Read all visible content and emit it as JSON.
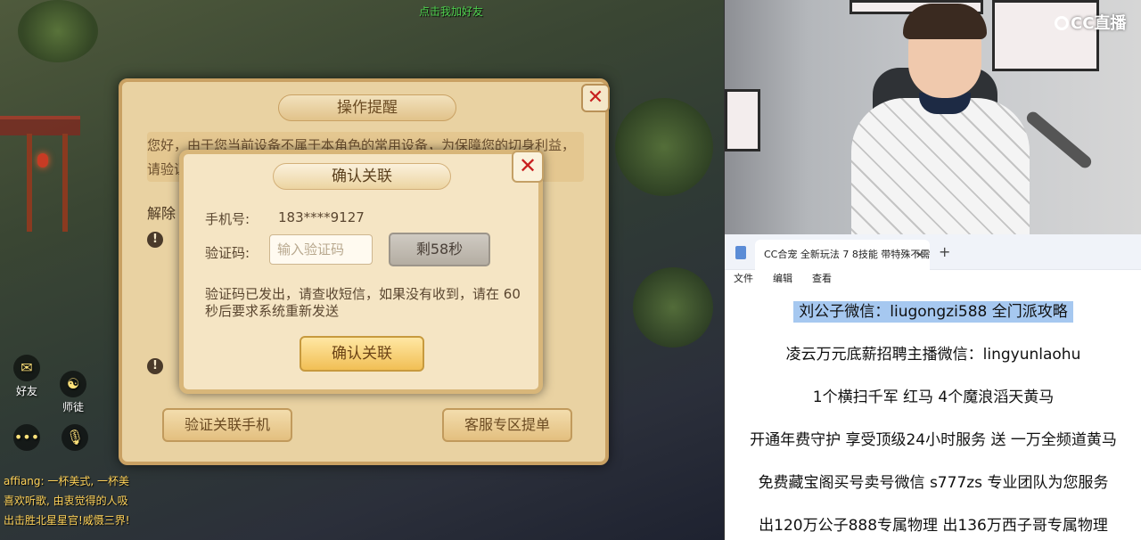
{
  "game": {
    "top_text": "点击我加好友",
    "side_buttons": [
      {
        "label": "好友",
        "icon": "mail-icon"
      },
      {
        "label": "师徒",
        "icon": "master-icon"
      },
      {
        "label": "",
        "icon": "chat-bubble-icon"
      },
      {
        "label": "",
        "icon": "microphone-icon"
      }
    ],
    "chat": [
      "affiang: 一杯美式, 一杯美",
      "  喜欢听歌, 由衷觉得的人吸",
      "出击胜北星星官!威慑三界!"
    ]
  },
  "outer_dialog": {
    "title": "操作提醒",
    "message": "您好，由于您当前设备不属于本角色的常用设备，为保障您的切身利益，请验证关联手机后再进行操作，谢谢您的配合。限制。",
    "section_label": "解除",
    "verify_button": "验证关联手机",
    "support_button": "客服专区提单"
  },
  "inner_dialog": {
    "title": "确认关联",
    "phone_label": "手机号:",
    "phone_value": "183****9127",
    "code_label": "验证码:",
    "code_placeholder": "输入验证码",
    "countdown_button": "剩58秒",
    "notice": "验证码已发出，请查收短信，如果没有收到，请在 60 秒后要求系统重新发送",
    "confirm_button": "确认关联"
  },
  "webcam": {
    "logo_text": "CC直播"
  },
  "notepad": {
    "tab_title": "CC合宠 全新玩法 7 8技能 带特殊不需",
    "tab_add": "+",
    "menu": [
      "文件",
      "编辑",
      "查看"
    ],
    "lines": [
      "刘公子微信：liugongzi588 全门派攻略",
      "凌云万元底薪招聘主播微信：lingyunlaohu",
      "1个横扫千军 红马     4个魔浪滔天黄马",
      "开通年费守护 享受顶级24小时服务 送 一万全频道黄马",
      "免费藏宝阁买号卖号微信 s777zs 专业团队为您服务",
      "出120万公子888专属物理    出136万西子哥专属物理"
    ],
    "highlight_color": "#a6c8f0"
  },
  "colors": {
    "dialog_bg": "#e9d2a2",
    "inner_bg": "#f5e5c4",
    "close_x": "#c81f1f",
    "confirm_gold": "#f1bf55"
  }
}
